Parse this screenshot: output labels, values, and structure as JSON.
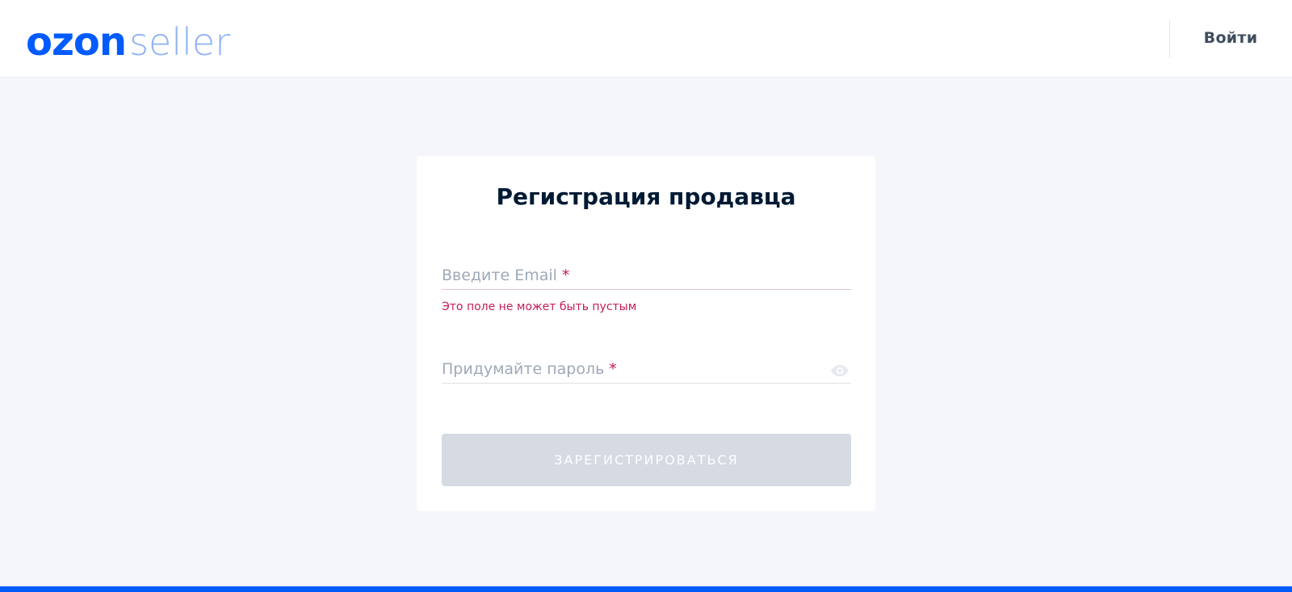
{
  "header": {
    "logo_primary": "ozon",
    "logo_secondary": "seller",
    "login_label": "Войти"
  },
  "form": {
    "title": "Регистрация продавца",
    "email": {
      "placeholder": "Введите Email",
      "required_mark": "*",
      "value": "",
      "error": "Это поле не может быть пустым"
    },
    "password": {
      "placeholder": "Придумайте пароль",
      "required_mark": "*",
      "value": "",
      "toggle_icon": "eye-icon"
    },
    "submit_label": "ЗАРЕГИСТРИРОВАТЬСЯ",
    "submit_enabled": false
  },
  "colors": {
    "brand_blue": "#005bff",
    "logo_light": "#8eb2f4",
    "error": "#c41c5a",
    "title": "#001a34",
    "disabled_button": "#d5dae3",
    "page_bg": "#f4f6f9"
  }
}
